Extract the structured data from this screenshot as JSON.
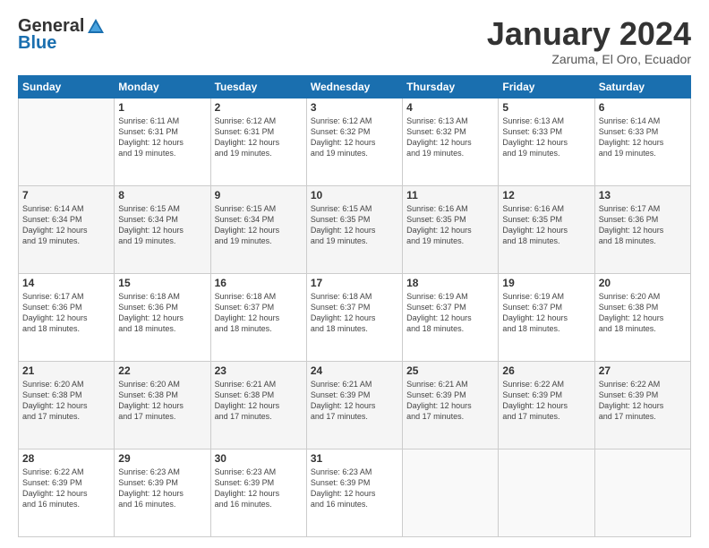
{
  "logo": {
    "general": "General",
    "blue": "Blue"
  },
  "header": {
    "month": "January 2024",
    "location": "Zaruma, El Oro, Ecuador"
  },
  "weekdays": [
    "Sunday",
    "Monday",
    "Tuesday",
    "Wednesday",
    "Thursday",
    "Friday",
    "Saturday"
  ],
  "days": [
    {
      "date": "",
      "number": "",
      "sunrise": "",
      "sunset": "",
      "daylight": ""
    },
    {
      "date": "1",
      "number": "1",
      "sunrise": "Sunrise: 6:11 AM",
      "sunset": "Sunset: 6:31 PM",
      "daylight": "Daylight: 12 hours and 19 minutes."
    },
    {
      "date": "2",
      "number": "2",
      "sunrise": "Sunrise: 6:12 AM",
      "sunset": "Sunset: 6:31 PM",
      "daylight": "Daylight: 12 hours and 19 minutes."
    },
    {
      "date": "3",
      "number": "3",
      "sunrise": "Sunrise: 6:12 AM",
      "sunset": "Sunset: 6:32 PM",
      "daylight": "Daylight: 12 hours and 19 minutes."
    },
    {
      "date": "4",
      "number": "4",
      "sunrise": "Sunrise: 6:13 AM",
      "sunset": "Sunset: 6:32 PM",
      "daylight": "Daylight: 12 hours and 19 minutes."
    },
    {
      "date": "5",
      "number": "5",
      "sunrise": "Sunrise: 6:13 AM",
      "sunset": "Sunset: 6:33 PM",
      "daylight": "Daylight: 12 hours and 19 minutes."
    },
    {
      "date": "6",
      "number": "6",
      "sunrise": "Sunrise: 6:14 AM",
      "sunset": "Sunset: 6:33 PM",
      "daylight": "Daylight: 12 hours and 19 minutes."
    },
    {
      "date": "7",
      "number": "7",
      "sunrise": "Sunrise: 6:14 AM",
      "sunset": "Sunset: 6:34 PM",
      "daylight": "Daylight: 12 hours and 19 minutes."
    },
    {
      "date": "8",
      "number": "8",
      "sunrise": "Sunrise: 6:15 AM",
      "sunset": "Sunset: 6:34 PM",
      "daylight": "Daylight: 12 hours and 19 minutes."
    },
    {
      "date": "9",
      "number": "9",
      "sunrise": "Sunrise: 6:15 AM",
      "sunset": "Sunset: 6:34 PM",
      "daylight": "Daylight: 12 hours and 19 minutes."
    },
    {
      "date": "10",
      "number": "10",
      "sunrise": "Sunrise: 6:15 AM",
      "sunset": "Sunset: 6:35 PM",
      "daylight": "Daylight: 12 hours and 19 minutes."
    },
    {
      "date": "11",
      "number": "11",
      "sunrise": "Sunrise: 6:16 AM",
      "sunset": "Sunset: 6:35 PM",
      "daylight": "Daylight: 12 hours and 19 minutes."
    },
    {
      "date": "12",
      "number": "12",
      "sunrise": "Sunrise: 6:16 AM",
      "sunset": "Sunset: 6:35 PM",
      "daylight": "Daylight: 12 hours and 18 minutes."
    },
    {
      "date": "13",
      "number": "13",
      "sunrise": "Sunrise: 6:17 AM",
      "sunset": "Sunset: 6:36 PM",
      "daylight": "Daylight: 12 hours and 18 minutes."
    },
    {
      "date": "14",
      "number": "14",
      "sunrise": "Sunrise: 6:17 AM",
      "sunset": "Sunset: 6:36 PM",
      "daylight": "Daylight: 12 hours and 18 minutes."
    },
    {
      "date": "15",
      "number": "15",
      "sunrise": "Sunrise: 6:18 AM",
      "sunset": "Sunset: 6:36 PM",
      "daylight": "Daylight: 12 hours and 18 minutes."
    },
    {
      "date": "16",
      "number": "16",
      "sunrise": "Sunrise: 6:18 AM",
      "sunset": "Sunset: 6:37 PM",
      "daylight": "Daylight: 12 hours and 18 minutes."
    },
    {
      "date": "17",
      "number": "17",
      "sunrise": "Sunrise: 6:18 AM",
      "sunset": "Sunset: 6:37 PM",
      "daylight": "Daylight: 12 hours and 18 minutes."
    },
    {
      "date": "18",
      "number": "18",
      "sunrise": "Sunrise: 6:19 AM",
      "sunset": "Sunset: 6:37 PM",
      "daylight": "Daylight: 12 hours and 18 minutes."
    },
    {
      "date": "19",
      "number": "19",
      "sunrise": "Sunrise: 6:19 AM",
      "sunset": "Sunset: 6:37 PM",
      "daylight": "Daylight: 12 hours and 18 minutes."
    },
    {
      "date": "20",
      "number": "20",
      "sunrise": "Sunrise: 6:20 AM",
      "sunset": "Sunset: 6:38 PM",
      "daylight": "Daylight: 12 hours and 18 minutes."
    },
    {
      "date": "21",
      "number": "21",
      "sunrise": "Sunrise: 6:20 AM",
      "sunset": "Sunset: 6:38 PM",
      "daylight": "Daylight: 12 hours and 17 minutes."
    },
    {
      "date": "22",
      "number": "22",
      "sunrise": "Sunrise: 6:20 AM",
      "sunset": "Sunset: 6:38 PM",
      "daylight": "Daylight: 12 hours and 17 minutes."
    },
    {
      "date": "23",
      "number": "23",
      "sunrise": "Sunrise: 6:21 AM",
      "sunset": "Sunset: 6:38 PM",
      "daylight": "Daylight: 12 hours and 17 minutes."
    },
    {
      "date": "24",
      "number": "24",
      "sunrise": "Sunrise: 6:21 AM",
      "sunset": "Sunset: 6:39 PM",
      "daylight": "Daylight: 12 hours and 17 minutes."
    },
    {
      "date": "25",
      "number": "25",
      "sunrise": "Sunrise: 6:21 AM",
      "sunset": "Sunset: 6:39 PM",
      "daylight": "Daylight: 12 hours and 17 minutes."
    },
    {
      "date": "26",
      "number": "26",
      "sunrise": "Sunrise: 6:22 AM",
      "sunset": "Sunset: 6:39 PM",
      "daylight": "Daylight: 12 hours and 17 minutes."
    },
    {
      "date": "27",
      "number": "27",
      "sunrise": "Sunrise: 6:22 AM",
      "sunset": "Sunset: 6:39 PM",
      "daylight": "Daylight: 12 hours and 17 minutes."
    },
    {
      "date": "28",
      "number": "28",
      "sunrise": "Sunrise: 6:22 AM",
      "sunset": "Sunset: 6:39 PM",
      "daylight": "Daylight: 12 hours and 16 minutes."
    },
    {
      "date": "29",
      "number": "29",
      "sunrise": "Sunrise: 6:23 AM",
      "sunset": "Sunset: 6:39 PM",
      "daylight": "Daylight: 12 hours and 16 minutes."
    },
    {
      "date": "30",
      "number": "30",
      "sunrise": "Sunrise: 6:23 AM",
      "sunset": "Sunset: 6:39 PM",
      "daylight": "Daylight: 12 hours and 16 minutes."
    },
    {
      "date": "31",
      "number": "31",
      "sunrise": "Sunrise: 6:23 AM",
      "sunset": "Sunset: 6:39 PM",
      "daylight": "Daylight: 12 hours and 16 minutes."
    }
  ]
}
